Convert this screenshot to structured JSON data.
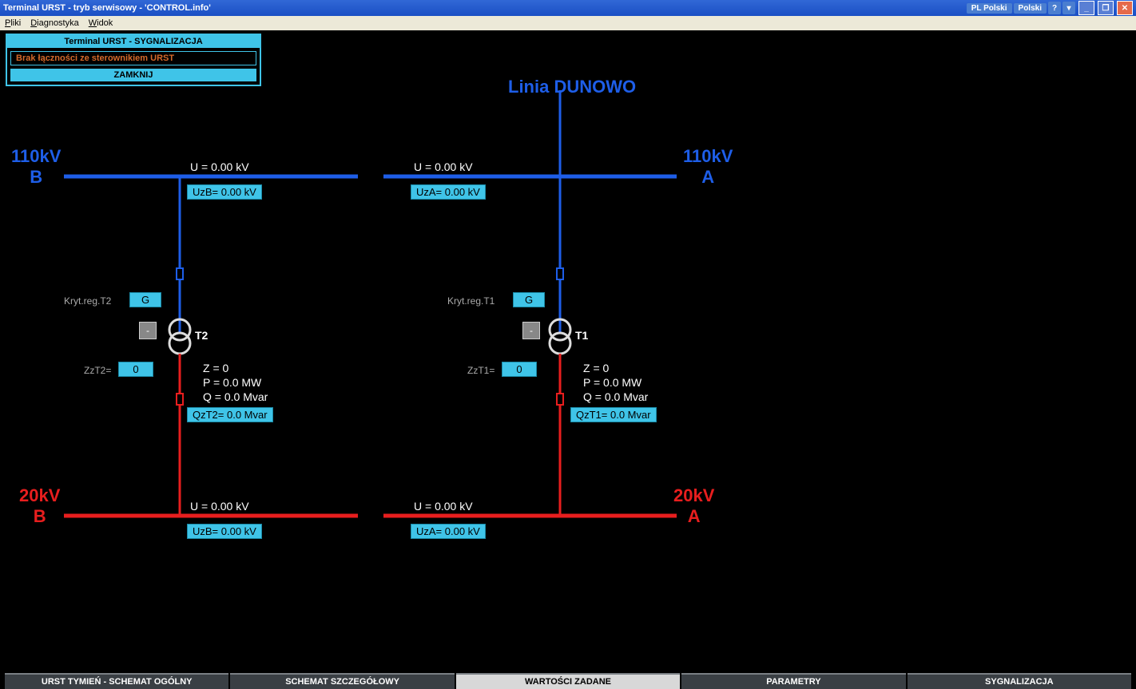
{
  "title_bar": {
    "title": "Terminal URST - tryb serwisowy - 'CONTROL.info'",
    "lang1": "PL Polski",
    "lang2": "Polski",
    "help": "?"
  },
  "menu": {
    "pliki": "Pliki",
    "diagnostyka": "Diagnostyka",
    "widok": "Widok"
  },
  "popup": {
    "title": "Terminal URST - SYGNALIZACJA",
    "msg": "Brak łączności ze sterownikiem URST",
    "btn": "ZAMKNIJ"
  },
  "diagram": {
    "line_label": "Linia DUNOWO",
    "bus_110B": {
      "v": "110kV",
      "l": "B"
    },
    "bus_110A": {
      "v": "110kV",
      "l": "A"
    },
    "bus_20B": {
      "v": "20kV",
      "l": "B"
    },
    "bus_20A": {
      "v": "20kV",
      "l": "A"
    },
    "u_label_b_top": "U = 0.00   kV",
    "u_label_a_top": "U = 0.00   kV",
    "u_label_b_bot": "U = 0.00   kV",
    "u_label_a_bot": "U = 0.00   kV",
    "uzb_top": "UzB=   0.00 kV",
    "uza_top": "UzA=   0.00 kV",
    "uzb_bot": "UzB=   0.00 kV",
    "uza_bot": "UzA=   0.00 kV",
    "kryt_t2": "Kryt.reg.T2",
    "kryt_t1": "Kryt.reg.T1",
    "g": "G",
    "dash": "-",
    "t2": "T2",
    "t1": "T1",
    "zzt2_label": "ZzT2=",
    "zzt1_label": "ZzT1=",
    "zero": "0",
    "z_line": "Z = 0",
    "p_line": "P = 0.0   MW",
    "q_line": "Q = 0.0   Mvar",
    "qzt2": "QzT2=   0.0 Mvar",
    "qzt1": "QzT1=   0.0 Mvar"
  },
  "tabs": {
    "t1": "URST TYMIEŃ - SCHEMAT OGÓLNY",
    "t2": "SCHEMAT SZCZEGÓŁOWY",
    "t3": "WARTOŚCI ZADANE",
    "t4": "PARAMETRY",
    "t5": "SYGNALIZACJA"
  }
}
